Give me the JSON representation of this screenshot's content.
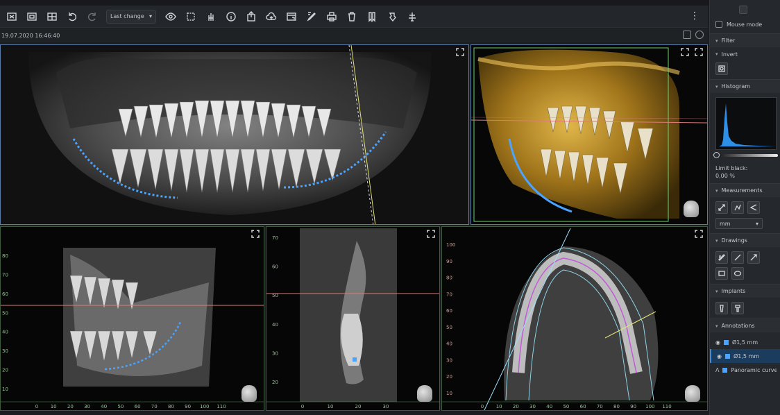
{
  "toolbar": {
    "history_select_label": "Last change",
    "buttons": [
      "close-study",
      "layout-single",
      "layout-grid",
      "undo",
      "redo",
      "view-eye",
      "select-area",
      "hand-tool",
      "info",
      "export",
      "upload",
      "window",
      "pen",
      "print",
      "delete",
      "bookmark",
      "reset-view",
      "implant-tool"
    ]
  },
  "status": {
    "datetime": "19.07.2020 16:46:40"
  },
  "viewports": {
    "panoramic": {
      "name": "panoramic-view"
    },
    "volume": {
      "name": "3d-volume-view"
    },
    "sagittal": {
      "name": "sagittal-view",
      "left_ticks": [
        "80",
        "70",
        "60",
        "50",
        "40",
        "30",
        "20",
        "10"
      ],
      "bottom_ticks": [
        "0",
        "10",
        "20",
        "30",
        "40",
        "50",
        "60",
        "70",
        "80",
        "90",
        "100",
        "110"
      ]
    },
    "cross": {
      "name": "cross-section-view",
      "left_ticks": [
        "70",
        "60",
        "50",
        "40",
        "30",
        "20"
      ],
      "bottom_ticks": [
        "0",
        "10",
        "20",
        "30"
      ]
    },
    "axial": {
      "name": "axial-view",
      "left_ticks": [
        "100",
        "90",
        "80",
        "70",
        "60",
        "50",
        "40",
        "30",
        "20",
        "10"
      ],
      "bottom_ticks": [
        "0",
        "10",
        "20",
        "30",
        "40",
        "50",
        "60",
        "70",
        "80",
        "90",
        "100",
        "110"
      ]
    }
  },
  "panel": {
    "mouse_mode_label": "Mouse mode",
    "filter_label": "Filter",
    "invert_label": "Invert",
    "histogram_label": "Histogram",
    "limit_black_label": "Limit black:",
    "limit_black_value": "0,00 %",
    "limit_black_fraction": 0.0,
    "measurements_label": "Measurements",
    "unit_value": "mm",
    "drawings_label": "Drawings",
    "implants_label": "Implants",
    "annotations_label": "Annotations",
    "annotations": [
      {
        "label": "Ø1,5 mm",
        "active": false
      },
      {
        "label": "Ø1,5 mm",
        "active": true
      },
      {
        "label": "Panoramic curve",
        "active": false
      }
    ]
  },
  "colors": {
    "accent": "#3f8fe0",
    "curve": "#4aa3ff",
    "green_axis": "#6fd36b",
    "red_axis": "#e07a7a",
    "yellow_line": "#e4e07a"
  }
}
